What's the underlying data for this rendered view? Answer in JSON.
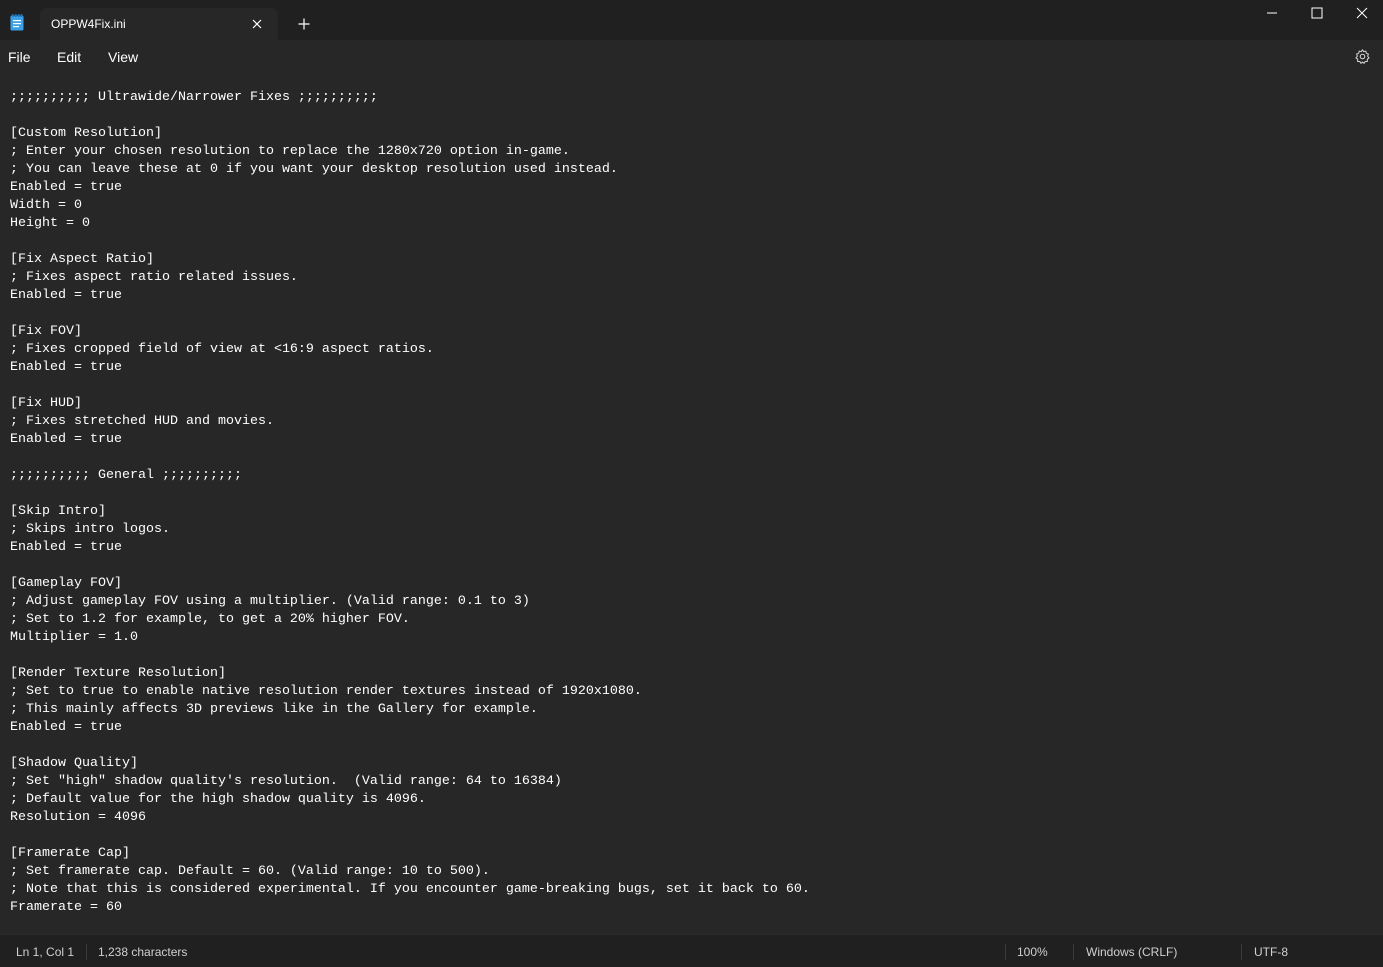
{
  "tab": {
    "title": "OPPW4Fix.ini"
  },
  "menu": {
    "file": "File",
    "edit": "Edit",
    "view": "View"
  },
  "editor": {
    "lines": [
      ";;;;;;;;;; Ultrawide/Narrower Fixes ;;;;;;;;;;",
      "",
      "[Custom Resolution]",
      "; Enter your chosen resolution to replace the 1280x720 option in-game.",
      "; You can leave these at 0 if you want your desktop resolution used instead.",
      "Enabled = true",
      "Width = 0",
      "Height = 0",
      "",
      "[Fix Aspect Ratio]",
      "; Fixes aspect ratio related issues.",
      "Enabled = true",
      "",
      "[Fix FOV]",
      "; Fixes cropped field of view at <16:9 aspect ratios.",
      "Enabled = true",
      "",
      "[Fix HUD]",
      "; Fixes stretched HUD and movies.",
      "Enabled = true",
      "",
      ";;;;;;;;;; General ;;;;;;;;;;",
      "",
      "[Skip Intro]",
      "; Skips intro logos.",
      "Enabled = true",
      "",
      "[Gameplay FOV]",
      "; Adjust gameplay FOV using a multiplier. (Valid range: 0.1 to 3)",
      "; Set to 1.2 for example, to get a 20% higher FOV.",
      "Multiplier = 1.0",
      "",
      "[Render Texture Resolution]",
      "; Set to true to enable native resolution render textures instead of 1920x1080.",
      "; This mainly affects 3D previews like in the Gallery for example.",
      "Enabled = true",
      "",
      "[Shadow Quality]",
      "; Set \"high\" shadow quality's resolution.  (Valid range: 64 to 16384)",
      "; Default value for the high shadow quality is 4096.",
      "Resolution = 4096",
      "",
      "[Framerate Cap]",
      "; Set framerate cap. Default = 60. (Valid range: 10 to 500).",
      "; Note that this is considered experimental. If you encounter game-breaking bugs, set it back to 60.",
      "Framerate = 60"
    ]
  },
  "status": {
    "position": "Ln 1, Col 1",
    "characters": "1,238 characters",
    "zoom": "100%",
    "line_ending": "Windows (CRLF)",
    "encoding": "UTF-8"
  },
  "icons": {
    "app": "notepad-icon",
    "close_tab": "close-icon",
    "new_tab": "plus-icon",
    "minimize": "minimize-icon",
    "maximize": "maximize-icon",
    "close_window": "close-icon",
    "settings": "gear-icon"
  }
}
